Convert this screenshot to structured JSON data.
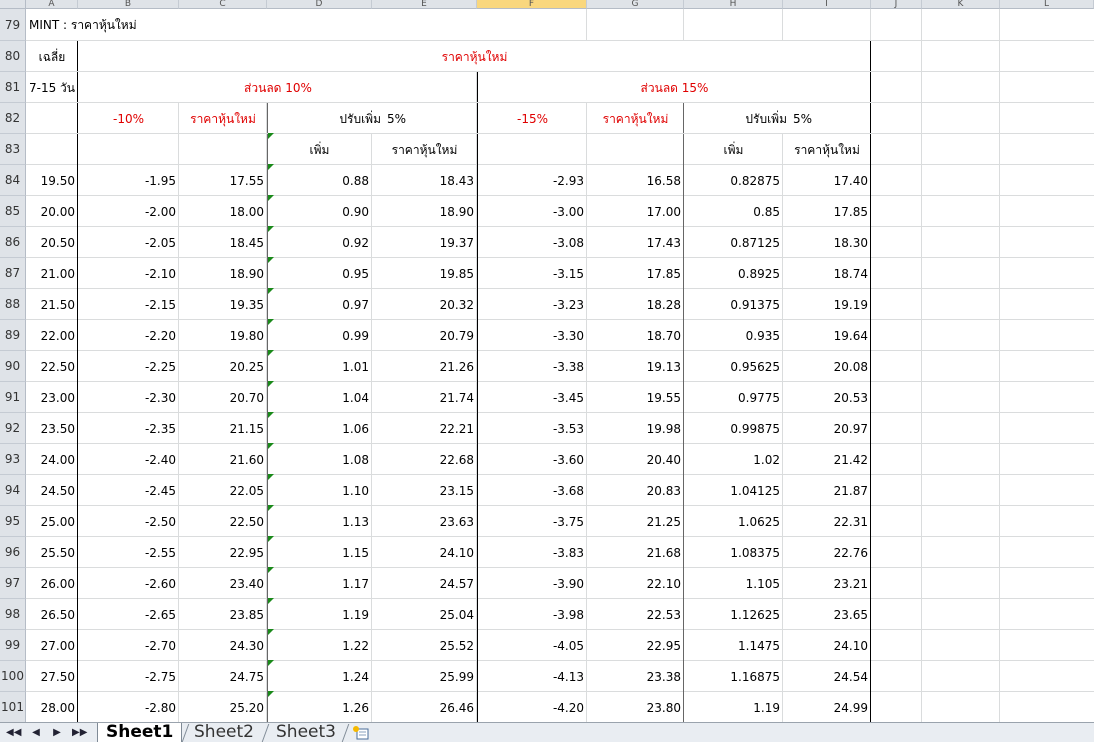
{
  "columns": [
    "A",
    "B",
    "C",
    "D",
    "E",
    "F",
    "G",
    "H",
    "I",
    "J",
    "K",
    "L"
  ],
  "selected_column": "F",
  "row_numbers": [
    "79",
    "80",
    "81",
    "82",
    "83",
    "84",
    "85",
    "86",
    "87",
    "88",
    "89",
    "90",
    "91",
    "92",
    "93",
    "94",
    "95",
    "96",
    "97",
    "98",
    "99",
    "100",
    "101"
  ],
  "headers": {
    "r79": "MINT :  ราคาหุ้นใหม่",
    "r80_a": "เฉลี่ย",
    "r80_title": "ราคาหุ้นใหม่",
    "r81_a": "7-15 วัน",
    "r81_left": "ส่วนลด   10%",
    "r81_right": "ส่วนลด   15%",
    "r82_b": "-10%",
    "r82_c": "ราคาหุ้นใหม่",
    "r82_d": "ปรับเพิ่ม",
    "r82_e": "5%",
    "r82_f": "-15%",
    "r82_g": "ราคาหุ้นใหม่",
    "r82_h": "ปรับเพิ่ม",
    "r82_i": "5%",
    "r83_d": "เพิ่ม",
    "r83_e": "ราคาหุ้นใหม่",
    "r83_h": "เพิ่ม",
    "r83_i": "ราคาหุ้นใหม่"
  },
  "rows": [
    [
      "19.50",
      "-1.95",
      "17.55",
      "0.88",
      "18.43",
      "-2.93",
      "16.58",
      "0.82875",
      "17.40"
    ],
    [
      "20.00",
      "-2.00",
      "18.00",
      "0.90",
      "18.90",
      "-3.00",
      "17.00",
      "0.85",
      "17.85"
    ],
    [
      "20.50",
      "-2.05",
      "18.45",
      "0.92",
      "19.37",
      "-3.08",
      "17.43",
      "0.87125",
      "18.30"
    ],
    [
      "21.00",
      "-2.10",
      "18.90",
      "0.95",
      "19.85",
      "-3.15",
      "17.85",
      "0.8925",
      "18.74"
    ],
    [
      "21.50",
      "-2.15",
      "19.35",
      "0.97",
      "20.32",
      "-3.23",
      "18.28",
      "0.91375",
      "19.19"
    ],
    [
      "22.00",
      "-2.20",
      "19.80",
      "0.99",
      "20.79",
      "-3.30",
      "18.70",
      "0.935",
      "19.64"
    ],
    [
      "22.50",
      "-2.25",
      "20.25",
      "1.01",
      "21.26",
      "-3.38",
      "19.13",
      "0.95625",
      "20.08"
    ],
    [
      "23.00",
      "-2.30",
      "20.70",
      "1.04",
      "21.74",
      "-3.45",
      "19.55",
      "0.9775",
      "20.53"
    ],
    [
      "23.50",
      "-2.35",
      "21.15",
      "1.06",
      "22.21",
      "-3.53",
      "19.98",
      "0.99875",
      "20.97"
    ],
    [
      "24.00",
      "-2.40",
      "21.60",
      "1.08",
      "22.68",
      "-3.60",
      "20.40",
      "1.02",
      "21.42"
    ],
    [
      "24.50",
      "-2.45",
      "22.05",
      "1.10",
      "23.15",
      "-3.68",
      "20.83",
      "1.04125",
      "21.87"
    ],
    [
      "25.00",
      "-2.50",
      "22.50",
      "1.13",
      "23.63",
      "-3.75",
      "21.25",
      "1.0625",
      "22.31"
    ],
    [
      "25.50",
      "-2.55",
      "22.95",
      "1.15",
      "24.10",
      "-3.83",
      "21.68",
      "1.08375",
      "22.76"
    ],
    [
      "26.00",
      "-2.60",
      "23.40",
      "1.17",
      "24.57",
      "-3.90",
      "22.10",
      "1.105",
      "23.21"
    ],
    [
      "26.50",
      "-2.65",
      "23.85",
      "1.19",
      "25.04",
      "-3.98",
      "22.53",
      "1.12625",
      "23.65"
    ],
    [
      "27.00",
      "-2.70",
      "24.30",
      "1.22",
      "25.52",
      "-4.05",
      "22.95",
      "1.1475",
      "24.10"
    ],
    [
      "27.50",
      "-2.75",
      "24.75",
      "1.24",
      "25.99",
      "-4.13",
      "23.38",
      "1.16875",
      "24.54"
    ],
    [
      "28.00",
      "-2.80",
      "25.20",
      "1.26",
      "26.46",
      "-4.20",
      "23.80",
      "1.19",
      "24.99"
    ]
  ],
  "tabs": [
    "Sheet1",
    "Sheet2",
    "Sheet3"
  ],
  "active_tab": "Sheet1",
  "colors": {
    "header_red": "#e00000",
    "error_triangle": "#1a8a1a",
    "selected_header": "#f9d77e"
  },
  "icons": [
    "first-sheet-icon",
    "prev-sheet-icon",
    "next-sheet-icon",
    "last-sheet-icon",
    "insert-sheet-icon"
  ]
}
